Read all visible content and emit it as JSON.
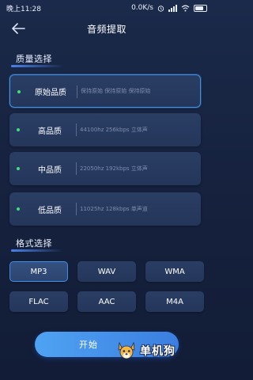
{
  "status_bar": {
    "time": "晚上11:28",
    "network_speed": "0.0K/s",
    "icons": [
      "alarm-icon",
      "signal-icon",
      "wifi-icon",
      "battery-icon"
    ]
  },
  "header": {
    "title": "音频提取",
    "back_icon": "back-arrow-icon"
  },
  "quality": {
    "section_title": "质量选择",
    "options": [
      {
        "name": "原始品质",
        "desc": "保持原始   保持原始   保持原始",
        "selected": true
      },
      {
        "name": "高品质",
        "desc": "44100hz   256kbps   立体声",
        "selected": false
      },
      {
        "name": "中品质",
        "desc": "22050hz   192kbps   立体声",
        "selected": false
      },
      {
        "name": "低品质",
        "desc": "11025hz   128kbps   单声道",
        "selected": false
      }
    ]
  },
  "format": {
    "section_title": "格式选择",
    "options": [
      {
        "label": "MP3",
        "selected": true
      },
      {
        "label": "WAV",
        "selected": false
      },
      {
        "label": "WMA",
        "selected": false
      },
      {
        "label": "FLAC",
        "selected": false
      },
      {
        "label": "AAC",
        "selected": false
      },
      {
        "label": "M4A",
        "selected": false
      }
    ]
  },
  "start_button": {
    "label": "开始"
  },
  "watermark": {
    "text": "单机狗"
  },
  "colors": {
    "accent": "#3f8fe6",
    "dot_green": "#3fe07a",
    "background": "#1b2a4a"
  }
}
